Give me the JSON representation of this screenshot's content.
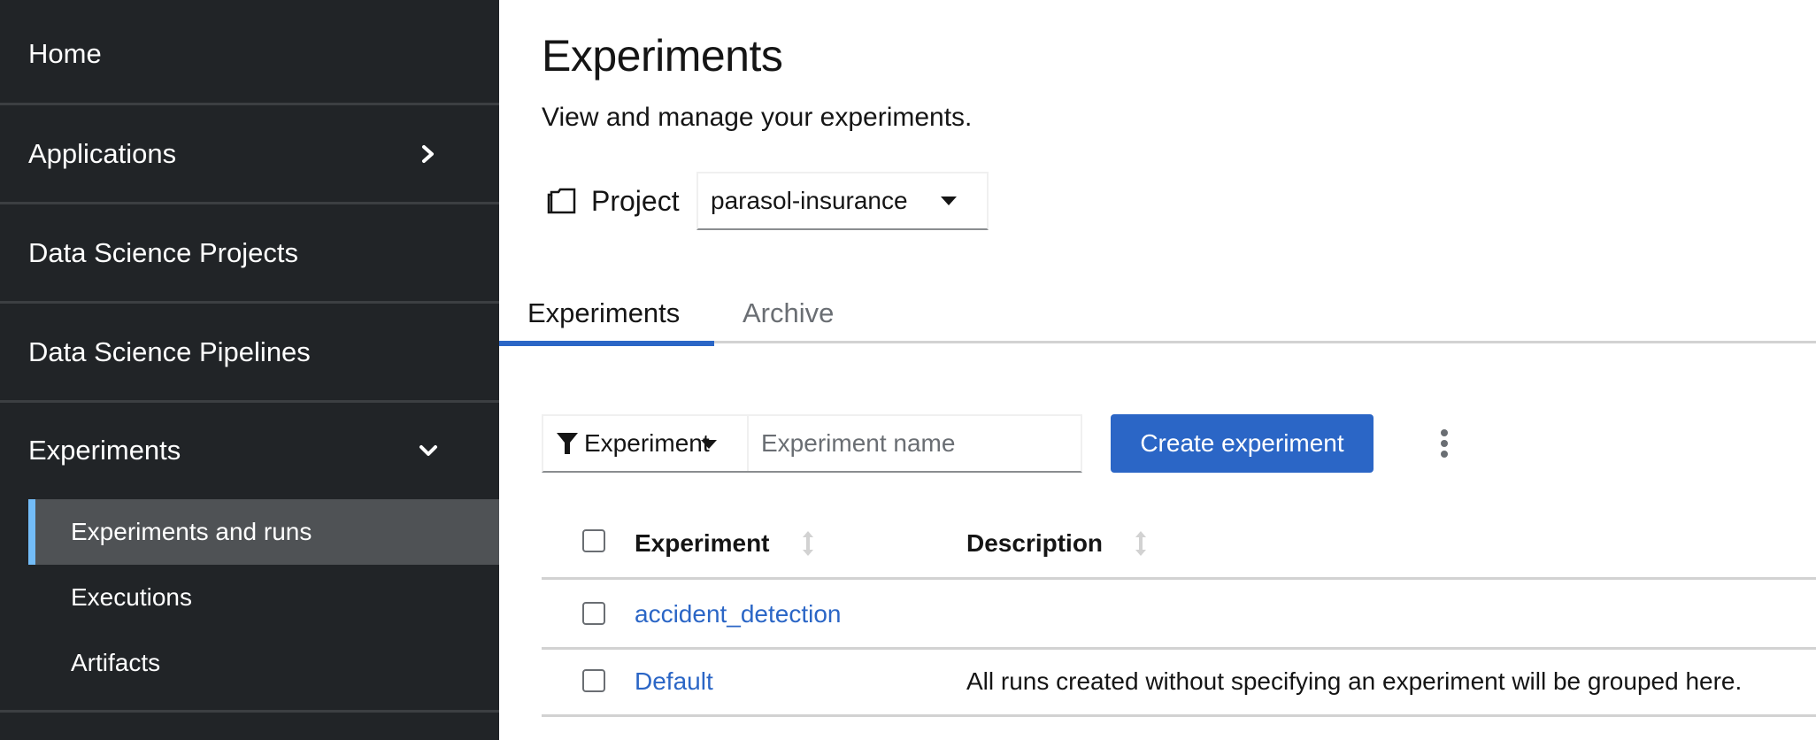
{
  "sidebar": {
    "items": [
      {
        "label": "Home",
        "icon": null
      },
      {
        "label": "Applications",
        "icon": "chevron-right-icon"
      },
      {
        "label": "Data Science Projects",
        "icon": null
      },
      {
        "label": "Data Science Pipelines",
        "icon": null
      },
      {
        "label": "Experiments",
        "icon": "chevron-down-icon",
        "expanded": true
      }
    ],
    "sub_items": [
      {
        "label": "Experiments and runs",
        "active": true
      },
      {
        "label": "Executions",
        "active": false
      },
      {
        "label": "Artifacts",
        "active": false
      }
    ],
    "accent_color": "#73bcf7"
  },
  "header": {
    "title": "Experiments",
    "subtitle": "View and manage your experiments.",
    "project_label": "Project",
    "project_icon": "folder-icon",
    "project_value": "parasol-insurance"
  },
  "tabs": [
    {
      "label": "Experiments",
      "active": true
    },
    {
      "label": "Archive",
      "active": false
    }
  ],
  "toolbar": {
    "filter_icon": "filter-icon",
    "filter_label": "Experiment",
    "search_placeholder": "Experiment name",
    "search_value": "",
    "create_label": "Create experiment",
    "kebab_icon": "kebab-icon",
    "primary_color": "#2b66c6"
  },
  "table": {
    "columns": [
      "Experiment",
      "Description"
    ],
    "rows": [
      {
        "name": "accident_detection",
        "description": ""
      },
      {
        "name": "Default",
        "description": "All runs created without specifying an experiment will be grouped here."
      }
    ]
  }
}
